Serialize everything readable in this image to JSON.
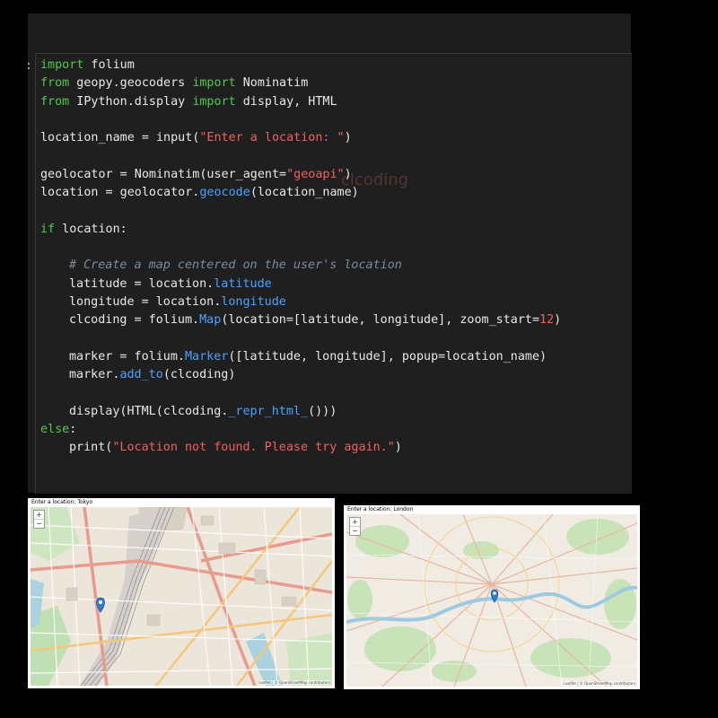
{
  "prompt_marker": ":",
  "watermark": "clcoding",
  "code_lines": [
    [
      {
        "t": "import",
        "c": "kw"
      },
      {
        "t": " folium"
      }
    ],
    [
      {
        "t": "from",
        "c": "kw"
      },
      {
        "t": " geopy.geocoders "
      },
      {
        "t": "import",
        "c": "kw"
      },
      {
        "t": " Nominatim"
      }
    ],
    [
      {
        "t": "from",
        "c": "kw"
      },
      {
        "t": " IPython.display "
      },
      {
        "t": "import",
        "c": "kw"
      },
      {
        "t": " display, HTML"
      }
    ],
    [],
    [
      {
        "t": "location_name = input("
      },
      {
        "t": "\"Enter a location: \"",
        "c": "str"
      },
      {
        "t": ")"
      }
    ],
    [],
    [
      {
        "t": "geolocator = Nominatim(user_agent="
      },
      {
        "t": "\"geoapi\"",
        "c": "str"
      },
      {
        "t": ")"
      }
    ],
    [
      {
        "t": "location = geolocator."
      },
      {
        "t": "geocode",
        "c": "attr"
      },
      {
        "t": "(location_name)"
      }
    ],
    [],
    [
      {
        "t": "if",
        "c": "kw"
      },
      {
        "t": " location:"
      }
    ],
    [],
    [
      {
        "i": 1
      },
      {
        "t": "# Create a map centered on the user's location",
        "c": "cm"
      }
    ],
    [
      {
        "i": 1
      },
      {
        "t": "latitude = location."
      },
      {
        "t": "latitude",
        "c": "attr"
      }
    ],
    [
      {
        "i": 1
      },
      {
        "t": "longitude = location."
      },
      {
        "t": "longitude",
        "c": "attr"
      }
    ],
    [
      {
        "i": 1
      },
      {
        "t": "clcoding = folium."
      },
      {
        "t": "Map",
        "c": "attr"
      },
      {
        "t": "(location=[latitude, longitude], zoom_start="
      },
      {
        "t": "12",
        "c": "str"
      },
      {
        "t": ")"
      }
    ],
    [],
    [
      {
        "i": 1
      },
      {
        "t": "marker = folium."
      },
      {
        "t": "Marker",
        "c": "attr"
      },
      {
        "t": "([latitude, longitude], popup=location_name)"
      }
    ],
    [
      {
        "i": 1
      },
      {
        "t": "marker."
      },
      {
        "t": "add_to",
        "c": "attr"
      },
      {
        "t": "(clcoding)"
      }
    ],
    [],
    [
      {
        "i": 1
      },
      {
        "t": "display(HTML(clcoding."
      },
      {
        "t": "_repr_html_",
        "c": "attr"
      },
      {
        "t": "()))"
      }
    ],
    [
      {
        "t": "else",
        "c": "kw"
      },
      {
        "t": ":"
      }
    ],
    [
      {
        "i": 1
      },
      {
        "t": "print("
      },
      {
        "t": "\"Location not found. Please try again.\"",
        "c": "str"
      },
      {
        "t": ")"
      }
    ]
  ],
  "outputs": {
    "tokyo": {
      "prompt_text": "Enter a location:  Tokyo",
      "zoom_in": "+",
      "zoom_out": "−",
      "attribution": "Leaflet | © OpenStreetMap contributors"
    },
    "london": {
      "prompt_text": "Enter a location:  London",
      "zoom_in": "+",
      "zoom_out": "−",
      "attribution": "Leaflet | © OpenStreetMap contributors"
    }
  },
  "colors": {
    "keyword": "#4ec94e",
    "string": "#f06060",
    "comment": "#7a8ca0",
    "attribute": "#4aa3ff",
    "marker": "#2e7bcf"
  },
  "icons": [
    "map-marker-icon",
    "zoom-in-icon",
    "zoom-out-icon"
  ]
}
